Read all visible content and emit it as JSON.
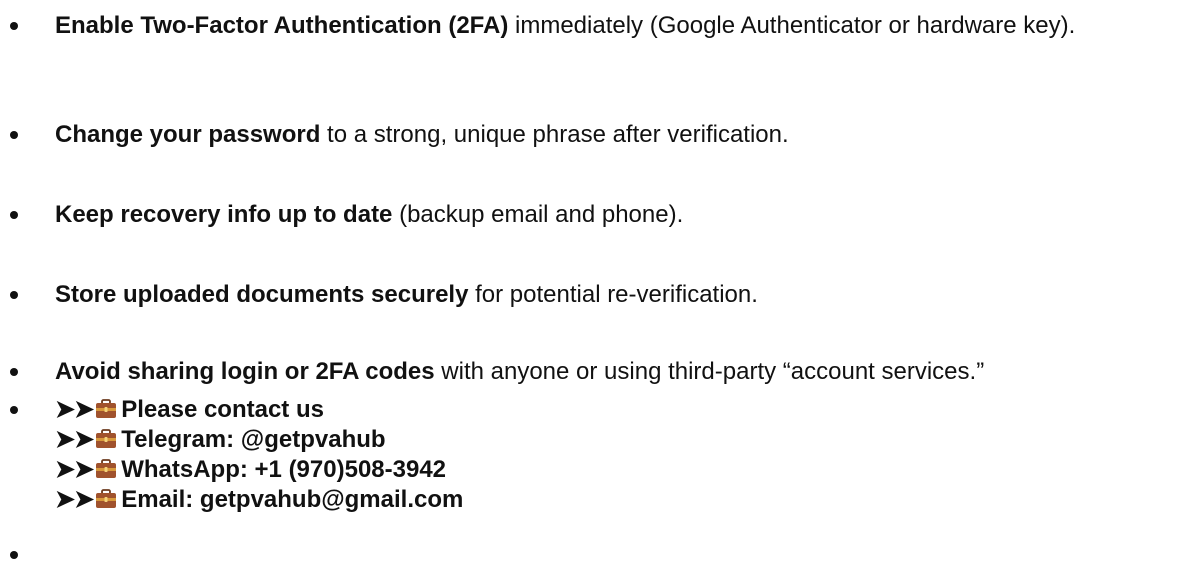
{
  "security_tips": [
    {
      "bold": "Enable Two-Factor Authentication (2FA)",
      "rest": " immediately (Google Authenticator or hardware key)."
    },
    {
      "bold": "Change your password",
      "rest": " to a strong, unique phrase after verification."
    },
    {
      "bold": "Keep recovery info up to date",
      "rest": " (backup email and phone)."
    },
    {
      "bold": "Store uploaded documents securely",
      "rest": " for potential re-verification."
    },
    {
      "bold": "Avoid sharing login or 2FA codes",
      "rest": " with anyone or using third-party “account services.”"
    }
  ],
  "contact": {
    "arrow_glyph": "➤➤",
    "icon": "briefcase-icon",
    "lines": [
      "Please contact us",
      "Telegram: @getpvahub",
      "WhatsApp: +1 (970)508-3942",
      "Email: getpvahub@gmail.com"
    ]
  },
  "colors": {
    "text": "#111111",
    "briefcase_body": "#a0522d",
    "briefcase_band": "#d89a3c"
  }
}
